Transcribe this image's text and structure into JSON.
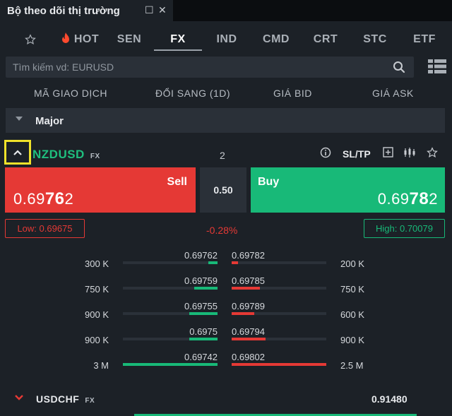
{
  "window": {
    "title": "Bộ theo dõi thị trường",
    "restore_icon": "☐",
    "close_icon": "✕"
  },
  "tabs": [
    {
      "label": "",
      "icon": "star-icon"
    },
    {
      "label": "HOT",
      "icon": "fire-icon"
    },
    {
      "label": "SEN"
    },
    {
      "label": "FX",
      "active": true
    },
    {
      "label": "IND"
    },
    {
      "label": "CMD"
    },
    {
      "label": "CRT"
    },
    {
      "label": "STC"
    },
    {
      "label": "ETF"
    }
  ],
  "search": {
    "placeholder": "Tìm kiếm vd: EURUSD",
    "value": ""
  },
  "columns": {
    "code": "MÃ GIAO DỊCH",
    "change": "ĐỔI SANG (1D)",
    "bid": "GIÁ BID",
    "ask": "GIÁ ASK"
  },
  "group": {
    "label": "Major"
  },
  "instrument": {
    "symbol": "NZDUSD",
    "tag": "FX",
    "spread": "2",
    "sltp": "SL/TP",
    "sell_label": "Sell",
    "buy_label": "Buy",
    "sell_price_pre": "0.69",
    "sell_price_big": "76",
    "sell_price_post": "2",
    "buy_price_pre": "0.69",
    "buy_price_big": "78",
    "buy_price_post": "2",
    "lot": "0.50",
    "low": "Low: 0.69675",
    "high": "High: 0.70079",
    "change": "-0.28%"
  },
  "depth": [
    {
      "bid_qty": "300 K",
      "bid": "0.69762",
      "ask": "0.69782",
      "ask_qty": "200 K",
      "bid_fill": 0.1,
      "ask_fill": 0.07
    },
    {
      "bid_qty": "750 K",
      "bid": "0.69759",
      "ask": "0.69785",
      "ask_qty": "750 K",
      "bid_fill": 0.25,
      "ask_fill": 0.3
    },
    {
      "bid_qty": "900 K",
      "bid": "0.69755",
      "ask": "0.69789",
      "ask_qty": "600 K",
      "bid_fill": 0.3,
      "ask_fill": 0.24
    },
    {
      "bid_qty": "900 K",
      "bid": "0.6975",
      "ask": "0.69794",
      "ask_qty": "900 K",
      "bid_fill": 0.3,
      "ask_fill": 0.36
    },
    {
      "bid_qty": "3 M",
      "bid": "0.69742",
      "ask": "0.69802",
      "ask_qty": "2.5 M",
      "bid_fill": 1.0,
      "ask_fill": 1.0
    }
  ],
  "next_instrument": {
    "symbol": "USDCHF",
    "tag": "FX",
    "price": "0.91480"
  },
  "colors": {
    "buy": "#18b978",
    "sell": "#e53935",
    "highlight": "#f0e22a"
  }
}
